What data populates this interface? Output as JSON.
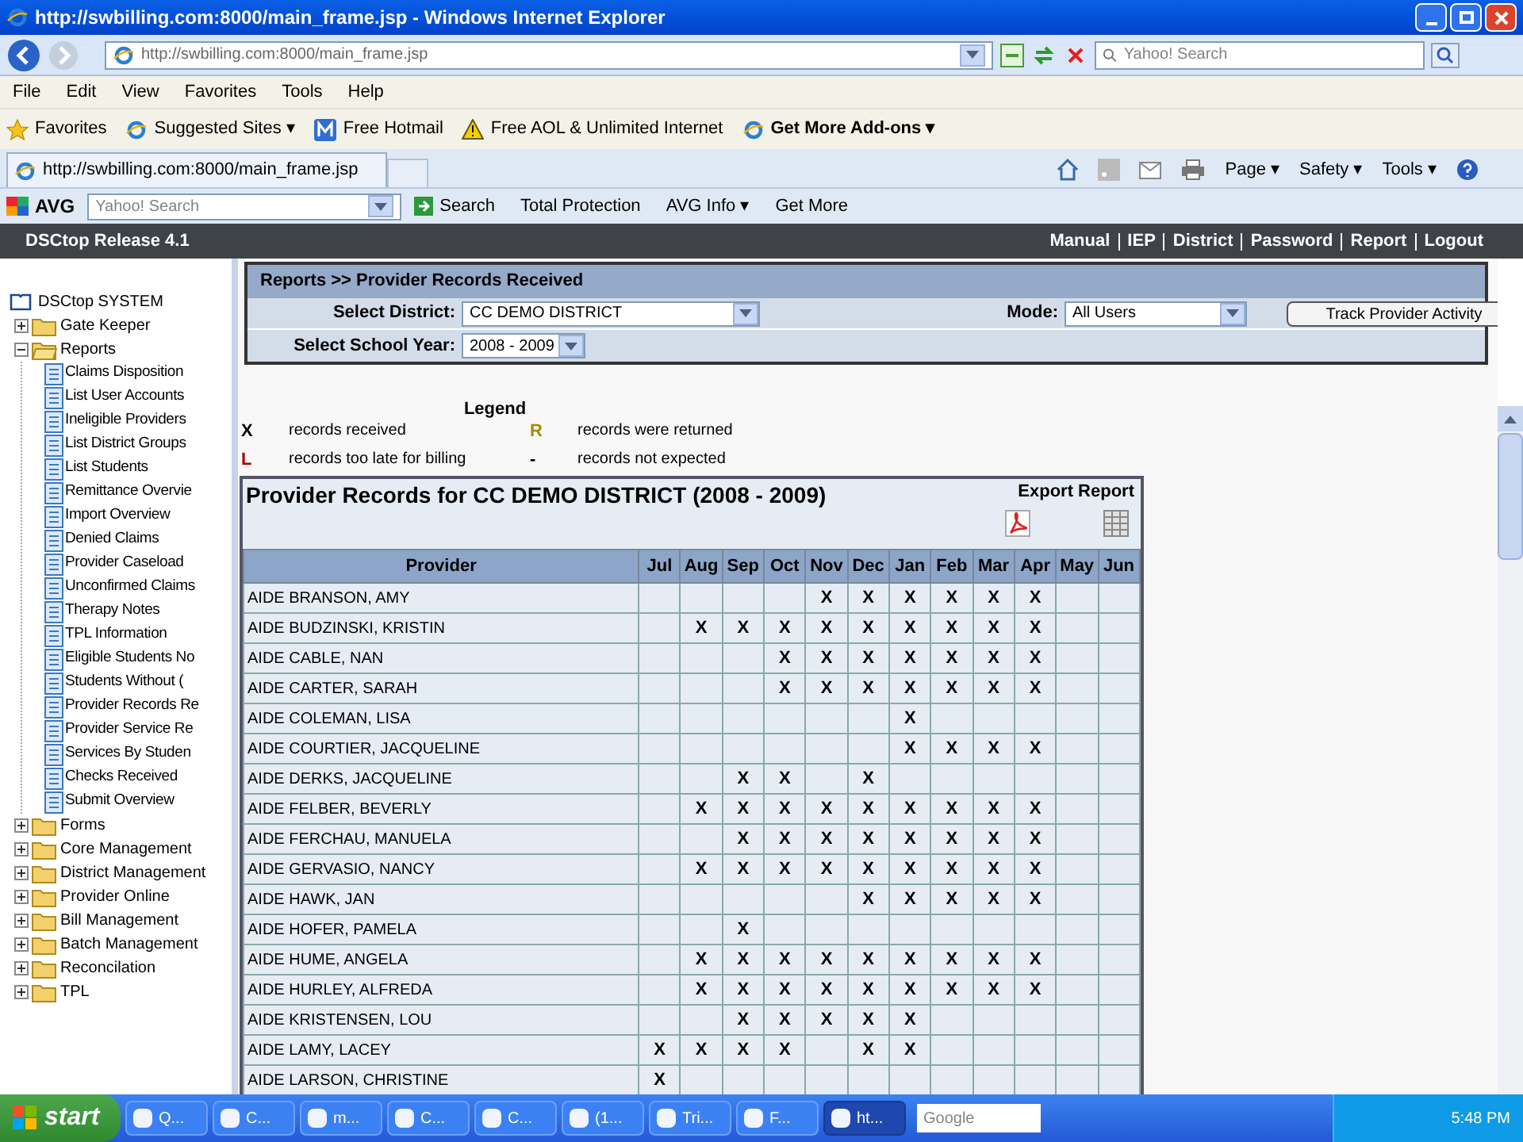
{
  "window": {
    "title": "http://swbilling.com:8000/main_frame.jsp - Windows Internet Explorer"
  },
  "address_bar": {
    "url": "http://swbilling.com:8000/main_frame.jsp"
  },
  "search": {
    "placeholder": "Yahoo! Search"
  },
  "menu": [
    "File",
    "Edit",
    "View",
    "Favorites",
    "Tools",
    "Help"
  ],
  "favorites_bar": [
    {
      "label": "Favorites",
      "kind": "star"
    },
    {
      "label": "Suggested Sites ▾",
      "kind": "ie"
    },
    {
      "label": "Free Hotmail",
      "kind": "hotmail"
    },
    {
      "label": "Free AOL & Unlimited Internet",
      "kind": "warning"
    },
    {
      "label": "Get More Add-ons ▾",
      "kind": "ie"
    }
  ],
  "tab": {
    "title": "http://swbilling.com:8000/main_frame.jsp"
  },
  "command_bar": [
    "Page ▾",
    "Safety ▾",
    "Tools ▾"
  ],
  "avg_toolbar": {
    "brand": "AVG",
    "search_placeholder": "Yahoo! Search",
    "search_button": "Search",
    "items": [
      "Total Protection",
      "AVG Info ▾",
      "Get More"
    ]
  },
  "app_header": {
    "title": "DSCtop Release 4.1",
    "links": [
      "Manual",
      "IEP",
      "District",
      "Password",
      "Report",
      "Logout"
    ]
  },
  "tree": {
    "root": "DSCtop SYSTEM",
    "items": [
      {
        "label": "Gate Keeper",
        "expanded": false
      },
      {
        "label": "Reports",
        "expanded": true,
        "children": [
          "Claims Disposition",
          "List User Accounts",
          "Ineligible Providers",
          "List District Groups",
          "List Students",
          "Remittance Overvie",
          "Import Overview",
          "Denied Claims",
          "Provider Caseload",
          "Unconfirmed Claims",
          "Therapy Notes",
          "TPL Information",
          "Eligible Students No",
          "Students Without (",
          "Provider Records Re",
          "Provider Service Re",
          "Services By Studen",
          "Checks Received",
          "Submit Overview"
        ]
      },
      {
        "label": "Forms",
        "expanded": false
      },
      {
        "label": "Core Management",
        "expanded": false
      },
      {
        "label": "District Management",
        "expanded": false
      },
      {
        "label": "Provider Online",
        "expanded": false
      },
      {
        "label": "Bill Management",
        "expanded": false
      },
      {
        "label": "Batch Management",
        "expanded": false
      },
      {
        "label": "Reconcilation",
        "expanded": false
      },
      {
        "label": "TPL",
        "expanded": false
      }
    ]
  },
  "filters": {
    "breadcrumb": "Reports >> Provider Records Received",
    "district_label": "Select District:",
    "district": "CC DEMO DISTRICT",
    "mode_label": "Mode:",
    "mode": "All Users",
    "track_button": "Track Provider Activity",
    "year_label": "Select School Year:",
    "year": "2008 - 2009"
  },
  "legend": {
    "title": "Legend",
    "items": [
      {
        "symbol": "X",
        "text": "records received",
        "color": "#000000"
      },
      {
        "symbol": "R",
        "text": "records were returned",
        "color": "#a09000"
      },
      {
        "symbol": "L",
        "text": "records too late for billing",
        "color": "#b00000"
      },
      {
        "symbol": "-",
        "text": "records not expected",
        "color": "#000000"
      }
    ]
  },
  "report": {
    "title": "Provider Records for CC DEMO DISTRICT (2008 - 2009)",
    "export_label": "Export Report",
    "columns": [
      "Provider",
      "Jul",
      "Aug",
      "Sep",
      "Oct",
      "Nov",
      "Dec",
      "Jan",
      "Feb",
      "Mar",
      "Apr",
      "May",
      "Jun"
    ],
    "rows": [
      {
        "cells": [
          "AIDE BRANSON, AMY",
          "",
          "",
          "",
          "",
          "X",
          "X",
          "X",
          "X",
          "X",
          "X",
          "",
          ""
        ]
      },
      {
        "cells": [
          "AIDE BUDZINSKI, KRISTIN",
          "",
          "X",
          "X",
          "X",
          "X",
          "X",
          "X",
          "X",
          "X",
          "X",
          "",
          ""
        ]
      },
      {
        "cells": [
          "AIDE CABLE, NAN",
          "",
          "",
          "",
          "X",
          "X",
          "X",
          "X",
          "X",
          "X",
          "X",
          "",
          ""
        ]
      },
      {
        "cells": [
          "AIDE CARTER, SARAH",
          "",
          "",
          "",
          "X",
          "X",
          "X",
          "X",
          "X",
          "X",
          "X",
          "",
          ""
        ]
      },
      {
        "cells": [
          "AIDE COLEMAN, LISA",
          "",
          "",
          "",
          "",
          "",
          "",
          "X",
          "",
          "",
          "",
          "",
          ""
        ]
      },
      {
        "cells": [
          "AIDE COURTIER, JACQUELINE",
          "",
          "",
          "",
          "",
          "",
          "",
          "X",
          "X",
          "X",
          "X",
          "",
          ""
        ]
      },
      {
        "cells": [
          "AIDE DERKS, JACQUELINE",
          "",
          "",
          "X",
          "X",
          "",
          "X",
          "",
          "",
          "",
          "",
          "",
          ""
        ]
      },
      {
        "cells": [
          "AIDE FELBER, BEVERLY",
          "",
          "X",
          "X",
          "X",
          "X",
          "X",
          "X",
          "X",
          "X",
          "X",
          "",
          ""
        ]
      },
      {
        "cells": [
          "AIDE FERCHAU, MANUELA",
          "",
          "",
          "X",
          "X",
          "X",
          "X",
          "X",
          "X",
          "X",
          "X",
          "",
          ""
        ]
      },
      {
        "cells": [
          "AIDE GERVASIO, NANCY",
          "",
          "X",
          "X",
          "X",
          "X",
          "X",
          "X",
          "X",
          "X",
          "X",
          "",
          ""
        ]
      },
      {
        "cells": [
          "AIDE HAWK, JAN",
          "",
          "",
          "",
          "",
          "",
          "X",
          "X",
          "X",
          "X",
          "X",
          "",
          ""
        ]
      },
      {
        "cells": [
          "AIDE HOFER, PAMELA",
          "",
          "",
          "X",
          "",
          "",
          "",
          "",
          "",
          "",
          "",
          "",
          ""
        ]
      },
      {
        "cells": [
          "AIDE HUME, ANGELA",
          "",
          "X",
          "X",
          "X",
          "X",
          "X",
          "X",
          "X",
          "X",
          "X",
          "",
          ""
        ]
      },
      {
        "cells": [
          "AIDE HURLEY, ALFREDA",
          "",
          "X",
          "X",
          "X",
          "X",
          "X",
          "X",
          "X",
          "X",
          "X",
          "",
          ""
        ]
      },
      {
        "cells": [
          "AIDE KRISTENSEN, LOU",
          "",
          "",
          "X",
          "X",
          "X",
          "X",
          "X",
          "",
          "",
          "",
          "",
          ""
        ]
      },
      {
        "cells": [
          "AIDE LAMY, LACEY",
          "X",
          "X",
          "X",
          "X",
          "",
          "X",
          "X",
          "",
          "",
          "",
          "",
          ""
        ]
      },
      {
        "cells": [
          "AIDE LARSON, CHRISTINE",
          "X",
          "",
          "",
          "",
          "",
          "",
          "",
          "",
          "",
          "",
          "",
          ""
        ]
      }
    ]
  },
  "taskbar": {
    "start": "start",
    "tasks": [
      {
        "label": "Q...",
        "selected": false
      },
      {
        "label": "C...",
        "selected": false
      },
      {
        "label": "m...",
        "selected": false
      },
      {
        "label": "C...",
        "selected": false
      },
      {
        "label": "C...",
        "selected": false
      },
      {
        "label": "(1...",
        "selected": false
      },
      {
        "label": "Tri...",
        "selected": false
      },
      {
        "label": "F...",
        "selected": false
      },
      {
        "label": "ht...",
        "selected": true
      }
    ],
    "search_placeholder": "Google",
    "clock": "5:48 PM"
  }
}
